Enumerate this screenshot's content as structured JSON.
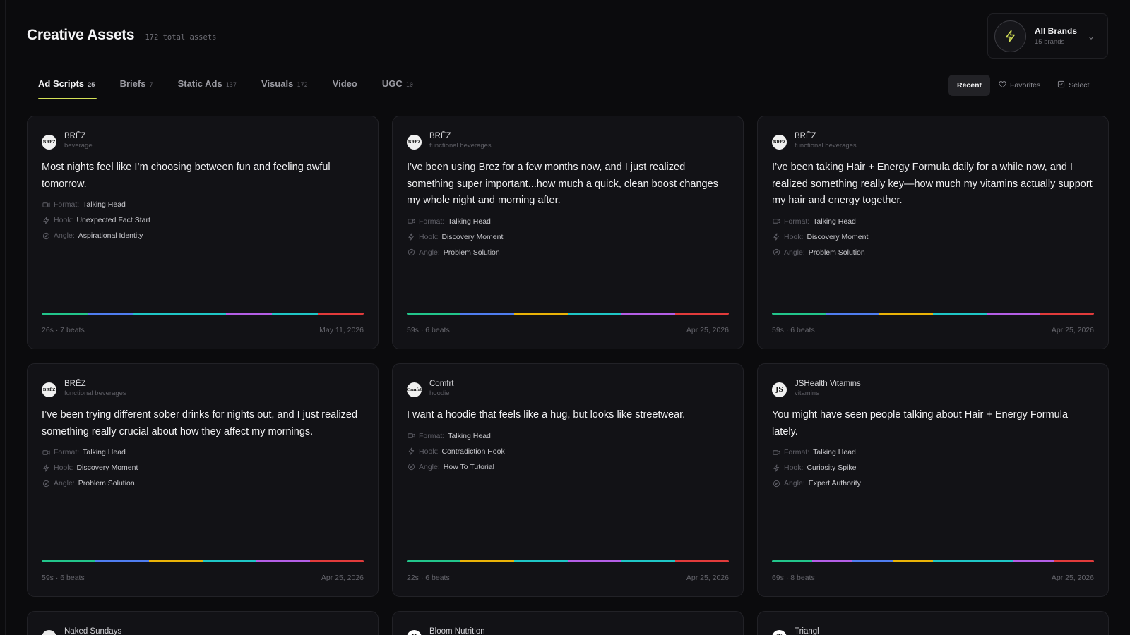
{
  "header": {
    "title": "Creative Assets",
    "subtitle": "172 total assets"
  },
  "brand_switcher": {
    "name": "All Brands",
    "count": "15 brands",
    "icon": "bolt-icon",
    "accent": "#d4e157"
  },
  "tabs": [
    {
      "label": "Ad Scripts",
      "count": "25"
    },
    {
      "label": "Briefs",
      "count": "7"
    },
    {
      "label": "Static Ads",
      "count": "137"
    },
    {
      "label": "Visuals",
      "count": "172"
    },
    {
      "label": "Video",
      "count": ""
    },
    {
      "label": "UGC",
      "count": "10"
    }
  ],
  "toolbar": {
    "recent": "Recent",
    "favorites": "Favorites",
    "select": "Select"
  },
  "labels": {
    "format": "Format:",
    "hook": "Hook:",
    "angle": "Angle:"
  },
  "beat_colors": {
    "green": "#22c58b",
    "blue": "#4f7df0",
    "cyan": "#1fc6c6",
    "yellow": "#eab308",
    "purple": "#b45ee6",
    "red": "#e13b3b"
  },
  "cards": [
    {
      "brand": "BRĒZ",
      "category": "beverage",
      "avatar": "BRĒZ",
      "text": "Most nights feel like I’m choosing between fun and feeling awful tomorrow.",
      "format": "Talking Head",
      "hook": "Unexpected Fact Start",
      "angle": "Aspirational Identity",
      "beats": [
        "green",
        "blue",
        "cyan",
        "cyan",
        "purple",
        "cyan",
        "red"
      ],
      "duration": "26s · 7 beats",
      "date": "May 11, 2026"
    },
    {
      "brand": "BRĒZ",
      "category": "functional beverages",
      "avatar": "BRĒZ",
      "text": "I’ve been using Brez for a few months now, and I just realized something super important...how much a quick, clean boost changes my whole night and morning after.",
      "format": "Talking Head",
      "hook": "Discovery Moment",
      "angle": "Problem Solution",
      "beats": [
        "green",
        "blue",
        "yellow",
        "cyan",
        "purple",
        "red"
      ],
      "duration": "59s · 6 beats",
      "date": "Apr 25, 2026"
    },
    {
      "brand": "BRĒZ",
      "category": "functional beverages",
      "avatar": "BRĒZ",
      "text": "I’ve been taking Hair + Energy Formula daily for a while now, and I realized something really key—how much my vitamins actually support my hair and energy together.",
      "format": "Talking Head",
      "hook": "Discovery Moment",
      "angle": "Problem Solution",
      "beats": [
        "green",
        "blue",
        "yellow",
        "cyan",
        "purple",
        "red"
      ],
      "duration": "59s · 6 beats",
      "date": "Apr 25, 2026"
    },
    {
      "brand": "BRĒZ",
      "category": "functional beverages",
      "avatar": "BRĒZ",
      "text": "I’ve been trying different sober drinks for nights out, and I just realized something really crucial about how they affect my mornings.",
      "format": "Talking Head",
      "hook": "Discovery Moment",
      "angle": "Problem Solution",
      "beats": [
        "green",
        "blue",
        "yellow",
        "cyan",
        "purple",
        "red"
      ],
      "duration": "59s · 6 beats",
      "date": "Apr 25, 2026"
    },
    {
      "brand": "Comfrt",
      "category": "hoodie",
      "avatar": "Comfrt",
      "text": "I want a hoodie that feels like a hug, but looks like streetwear.",
      "format": "Talking Head",
      "hook": "Contradiction Hook",
      "angle": "How To Tutorial",
      "beats": [
        "green",
        "yellow",
        "cyan",
        "purple",
        "cyan",
        "red"
      ],
      "duration": "22s · 6 beats",
      "date": "Apr 25, 2026"
    },
    {
      "brand": "JSHealth Vitamins",
      "category": "vitamins",
      "avatar": "JS",
      "text": "You might have seen people talking about Hair + Energy Formula lately.",
      "format": "Talking Head",
      "hook": "Curiosity Spike",
      "angle": "Expert Authority",
      "beats": [
        "green",
        "purple",
        "blue",
        "yellow",
        "cyan",
        "cyan",
        "purple",
        "red"
      ],
      "duration": "69s · 8 beats",
      "date": "Apr 25, 2026"
    },
    {
      "brand": "Naked Sundays",
      "avatar": "AKE"
    },
    {
      "brand": "Bloom Nutrition",
      "avatar": "B"
    },
    {
      "brand": "Triangl",
      "avatar": "T"
    }
  ]
}
